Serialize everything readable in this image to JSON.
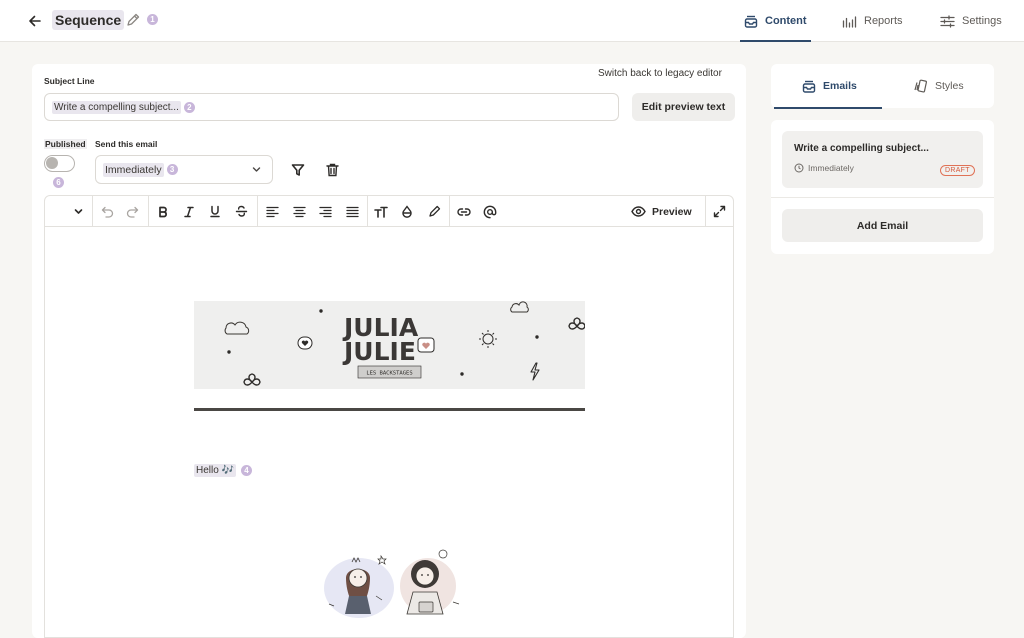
{
  "header": {
    "title": "Sequence",
    "marker": "1",
    "tabs": [
      {
        "label": "Content",
        "icon": "inbox-icon",
        "active": true
      },
      {
        "label": "Reports",
        "icon": "chart-icon",
        "active": false
      },
      {
        "label": "Settings",
        "icon": "sliders-icon",
        "active": false
      }
    ]
  },
  "editor_form": {
    "legacy_link": "Switch back to legacy editor",
    "subject_label": "Subject Line",
    "subject_value": "Write a compelling subject...",
    "subject_marker": "2",
    "edit_preview_label": "Edit preview text",
    "published_label": "Published",
    "published_marker": "6",
    "send_label": "Send this email",
    "send_value": "Immediately",
    "send_marker": "3"
  },
  "toolbar": {
    "preview_label": "Preview"
  },
  "email_body": {
    "hello_text": "Hello 🎶",
    "hello_marker": "4",
    "banner_logo_line1": "JULIA",
    "banner_logo_line2": "JULIE",
    "banner_subtitle": "LES BACKSTAGES"
  },
  "sidebar": {
    "tabs": [
      {
        "label": "Emails",
        "icon": "mail-stack-icon",
        "active": true
      },
      {
        "label": "Styles",
        "icon": "brush-icon",
        "active": false
      }
    ],
    "email_card": {
      "title": "Write a compelling subject...",
      "schedule": "Immediately",
      "badge": "DRAFT"
    },
    "add_email_label": "Add Email"
  },
  "colors": {
    "accent": "#2f4a6b",
    "marker": "#c8b6da",
    "draft": "#d65a3c",
    "background": "#f7f6f3"
  }
}
